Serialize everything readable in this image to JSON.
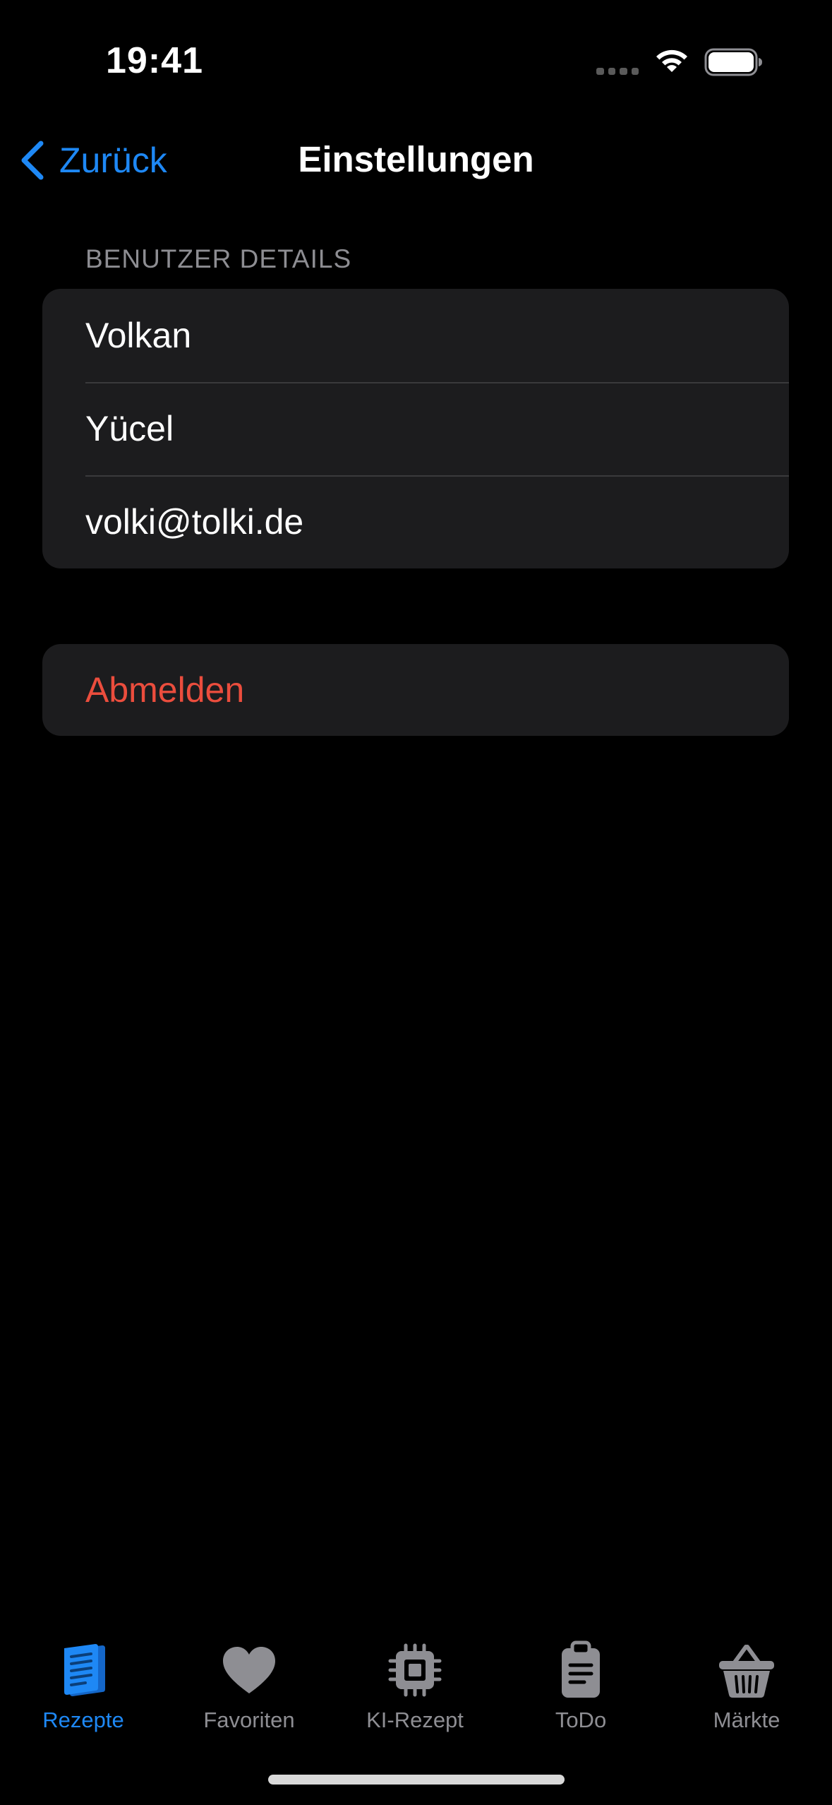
{
  "status_bar": {
    "time": "19:41",
    "wifi_icon": "wifi-icon",
    "battery_icon": "battery-icon"
  },
  "nav": {
    "back_label": "Zurück",
    "title": "Einstellungen",
    "accent": "#1e88f5"
  },
  "user_details": {
    "header": "BENUTZER DETAILS",
    "rows": [
      "Volkan",
      "Yücel",
      "volki@tolki.de"
    ]
  },
  "logout": {
    "label": "Abmelden",
    "color": "#eb4d3d"
  },
  "tab_bar": {
    "tabs": [
      {
        "label": "Rezepte",
        "icon": "document-icon",
        "active": true
      },
      {
        "label": "Favoriten",
        "icon": "heart-icon",
        "active": false
      },
      {
        "label": "KI-Rezept",
        "icon": "cpu-chip-icon",
        "active": false
      },
      {
        "label": "ToDo",
        "icon": "clipboard-icon",
        "active": false
      },
      {
        "label": "Märkte",
        "icon": "basket-icon",
        "active": false
      }
    ]
  }
}
